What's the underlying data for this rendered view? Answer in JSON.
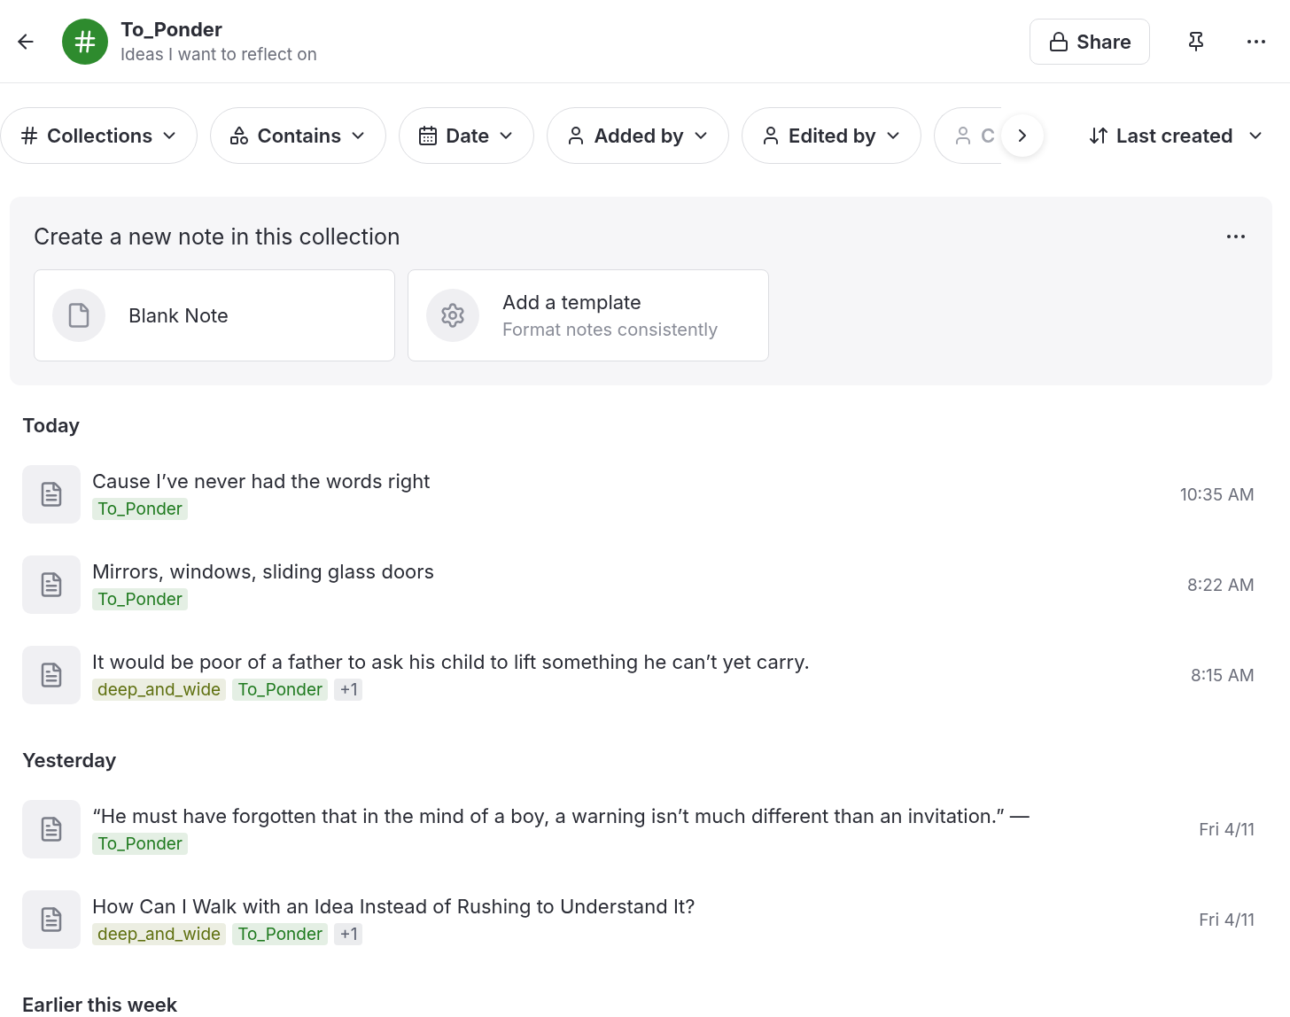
{
  "header": {
    "title": "To_Ponder",
    "subtitle": "Ideas I want to reflect on",
    "share_button": "Share"
  },
  "filters": [
    {
      "kind": "collection",
      "label": "Collections"
    },
    {
      "kind": "contains",
      "label": "Contains"
    },
    {
      "kind": "date",
      "label": "Date"
    },
    {
      "kind": "person",
      "label": "Added by"
    },
    {
      "kind": "person",
      "label": "Edited by"
    },
    {
      "kind": "person",
      "label": "C"
    }
  ],
  "sort": {
    "label": "Last created"
  },
  "create_panel": {
    "title": "Create a new note in this collection",
    "options": [
      {
        "kind": "blank",
        "title": "Blank Note"
      },
      {
        "kind": "template",
        "title": "Add a template",
        "subtitle": "Format notes consistently"
      }
    ]
  },
  "sections": [
    {
      "title": "Today",
      "notes": [
        {
          "title": "Cause I’ve never had the words right",
          "time": "10:35 AM",
          "tags": [
            {
              "label": "To_Ponder",
              "color": "#1f7a1f"
            }
          ]
        },
        {
          "title": "Mirrors, windows, sliding glass doors",
          "time": "8:22 AM",
          "tags": [
            {
              "label": "To_Ponder",
              "color": "#1f7a1f"
            }
          ]
        },
        {
          "title": "It would be poor of a father to ask his child to lift something he can’t yet carry.",
          "time": "8:15 AM",
          "tags": [
            {
              "label": "deep_and_wide",
              "color": "#5f7010"
            },
            {
              "label": "To_Ponder",
              "color": "#1f7a1f"
            },
            {
              "label": "+1",
              "color": "#5b6070"
            }
          ]
        }
      ]
    },
    {
      "title": "Yesterday",
      "notes": [
        {
          "title": "“He must have forgotten that in the mind of a boy, a warning isn’t much different than an invitation.” —",
          "time": "Fri 4/11",
          "tags": [
            {
              "label": "To_Ponder",
              "color": "#1f7a1f"
            }
          ]
        },
        {
          "title": "How Can I Walk with an Idea Instead of Rushing to Understand It?",
          "time": "Fri 4/11",
          "tags": [
            {
              "label": "deep_and_wide",
              "color": "#5f7010"
            },
            {
              "label": "To_Ponder",
              "color": "#1f7a1f"
            },
            {
              "label": "+1",
              "color": "#5b6070"
            }
          ]
        }
      ]
    },
    {
      "title": "Earlier this week"
    }
  ]
}
